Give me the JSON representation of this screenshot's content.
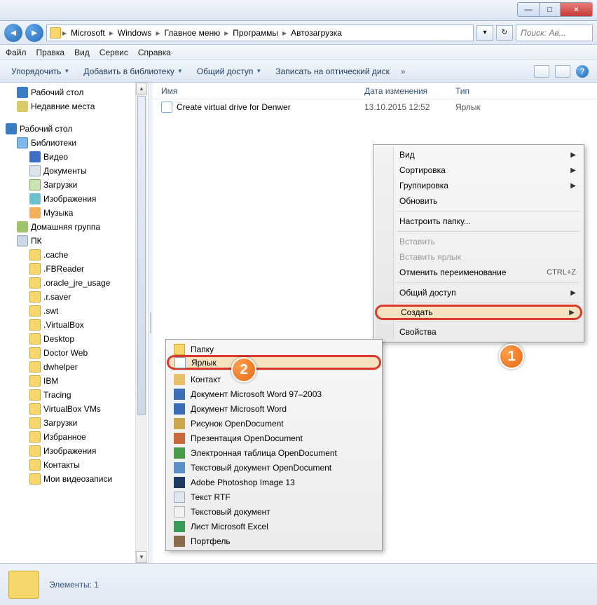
{
  "win": {
    "min": "—",
    "max": "□",
    "close": "×"
  },
  "breadcrumbs": [
    "Microsoft",
    "Windows",
    "Главное меню",
    "Программы",
    "Автозагрузка"
  ],
  "search_placeholder": "Поиск: Ав...",
  "menu": {
    "file": "Файл",
    "edit": "Правка",
    "view": "Вид",
    "tools": "Сервис",
    "help": "Справка"
  },
  "toolbar": {
    "organize": "Упорядочить",
    "addlib": "Добавить в библиотеку",
    "share": "Общий доступ",
    "burn": "Записать на оптический диск",
    "more": "»"
  },
  "tree": {
    "quick": [
      "Рабочий стол",
      "Недавние места"
    ],
    "desktop": "Рабочий стол",
    "libs": "Библиотеки",
    "lib_items": [
      "Видео",
      "Документы",
      "Загрузки",
      "Изображения",
      "Музыка"
    ],
    "homegroup": "Домашняя группа",
    "pc": "ПК",
    "folders": [
      ".cache",
      ".FBReader",
      ".oracle_jre_usage",
      ".r.saver",
      ".swt",
      ".VirtualBox",
      "Desktop",
      "Doctor Web",
      "dwhelper",
      "IBM",
      "Tracing",
      "VirtualBox VMs",
      "Загрузки",
      "Избранное",
      "Изображения",
      "Контакты",
      "Мои видеозаписи"
    ]
  },
  "columns": {
    "name": "Имя",
    "date": "Дата изменения",
    "type": "Тип"
  },
  "file": {
    "name": "Create virtual drive for Denwer",
    "date": "13.10.2015 12:52",
    "type": "Ярлык"
  },
  "ctx": {
    "view": "Вид",
    "sort": "Сортировка",
    "group": "Группировка",
    "refresh": "Обновить",
    "customize": "Настроить папку...",
    "paste": "Вставить",
    "paste_shortcut": "Вставить ярлык",
    "undo_rename": "Отменить переименование",
    "undo_kb": "CTRL+Z",
    "share": "Общий доступ",
    "create": "Создать",
    "props": "Свойства"
  },
  "sub": [
    "Папку",
    "Ярлык",
    "Контакт",
    "Документ Microsoft Word 97–2003",
    "Документ Microsoft Word",
    "Рисунок OpenDocument",
    "Презентация OpenDocument",
    "Электронная таблица OpenDocument",
    "Текстовый документ OpenDocument",
    "Adobe Photoshop Image 13",
    "Текст RTF",
    "Текстовый документ",
    "Лист Microsoft Excel",
    "Портфель"
  ],
  "badges": {
    "one": "1",
    "two": "2"
  },
  "status": {
    "label": "Элементы: 1"
  }
}
